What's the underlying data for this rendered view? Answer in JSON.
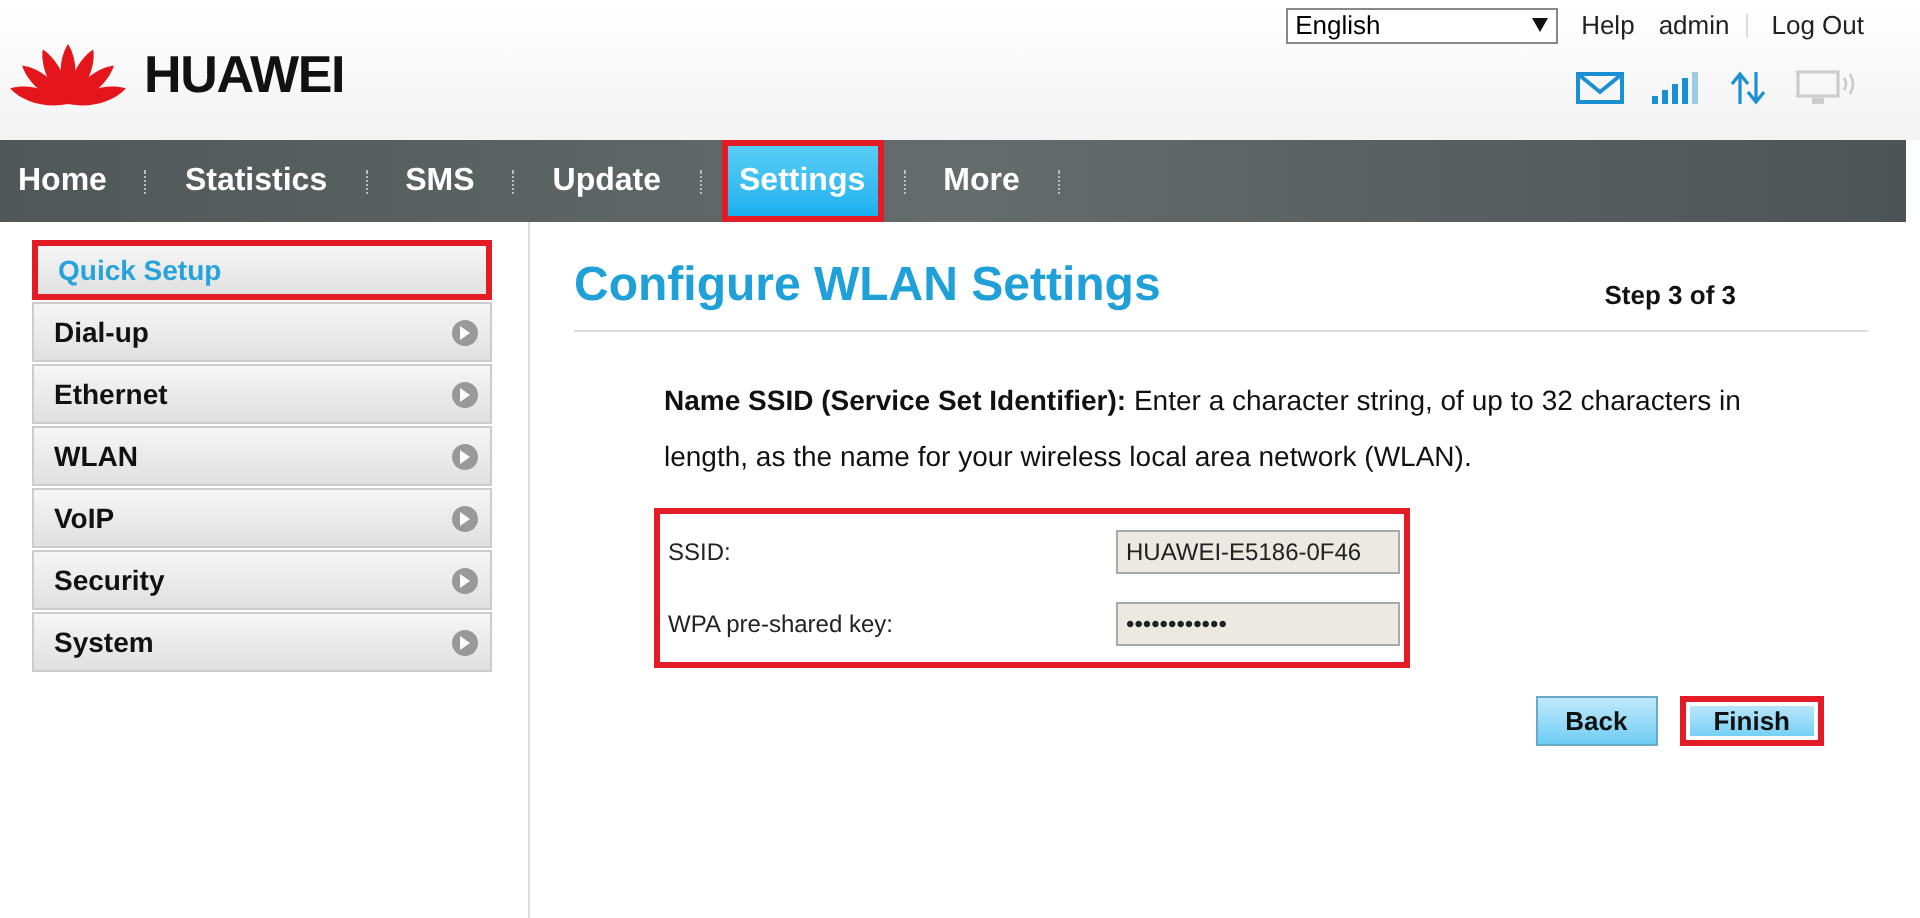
{
  "header": {
    "logo_text": "HUAWEI",
    "language": "English",
    "links": [
      {
        "label": "Help"
      },
      {
        "label": "admin"
      },
      {
        "label": "Log Out"
      }
    ]
  },
  "nav": [
    {
      "label": "Home",
      "selected": false,
      "highlighted": false
    },
    {
      "label": "Statistics",
      "selected": false,
      "highlighted": false
    },
    {
      "label": "SMS",
      "selected": false,
      "highlighted": false
    },
    {
      "label": "Update",
      "selected": false,
      "highlighted": false
    },
    {
      "label": "Settings",
      "selected": true,
      "highlighted": true
    },
    {
      "label": "More",
      "selected": false,
      "highlighted": false
    }
  ],
  "sidebar": {
    "items": [
      {
        "label": "Quick Setup",
        "selected": true,
        "highlighted": true
      },
      {
        "label": "Dial-up",
        "selected": false,
        "highlighted": false
      },
      {
        "label": "Ethernet",
        "selected": false,
        "highlighted": false
      },
      {
        "label": "WLAN",
        "selected": false,
        "highlighted": false
      },
      {
        "label": "VoIP",
        "selected": false,
        "highlighted": false
      },
      {
        "label": "Security",
        "selected": false,
        "highlighted": false
      },
      {
        "label": "System",
        "selected": false,
        "highlighted": false
      }
    ]
  },
  "content": {
    "title": "Configure WLAN Settings",
    "step": "Step 3 of 3",
    "description": "**Name SSID (Service Set Identifier):** Enter a character string, of up to 32 characters in length, as the name for your wireless local area network (WLAN).",
    "fields_highlighted": true,
    "fields": [
      {
        "label": "SSID:",
        "value": "HUAWEI-E5186-0F46"
      },
      {
        "label": "WPA pre-shared key:",
        "value": "••••••••••••"
      }
    ],
    "buttons": [
      {
        "label": "Back",
        "highlighted": false
      },
      {
        "label": "Finish",
        "highlighted": true
      }
    ]
  }
}
